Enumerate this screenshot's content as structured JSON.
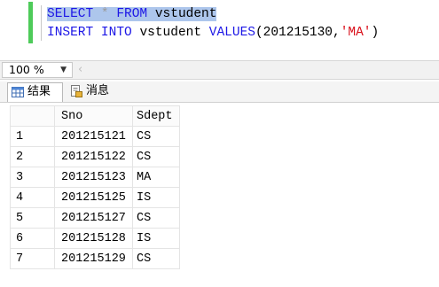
{
  "editor": {
    "line1": {
      "kw_select": "SELECT",
      "star": "*",
      "kw_from": "FROM",
      "table": "vstudent"
    },
    "line2": {
      "kw_insert": "INSERT",
      "kw_into": "INTO",
      "table": "vstudent",
      "kw_values": "VALUES",
      "args_open": "(201215130,",
      "str_val": "'MA'",
      "args_close": ")"
    }
  },
  "zoom": {
    "value": "100 %"
  },
  "tabs": {
    "results_label": "结果",
    "messages_label": "消息"
  },
  "grid": {
    "columns": [
      "",
      "Sno",
      "Sdept"
    ],
    "rows": [
      {
        "num": "1",
        "sno": "201215121",
        "sdept": "CS"
      },
      {
        "num": "2",
        "sno": "201215122",
        "sdept": "CS"
      },
      {
        "num": "3",
        "sno": "201215123",
        "sdept": "MA"
      },
      {
        "num": "4",
        "sno": "201215125",
        "sdept": "IS"
      },
      {
        "num": "5",
        "sno": "201215127",
        "sdept": "CS"
      },
      {
        "num": "6",
        "sno": "201215128",
        "sdept": "IS"
      },
      {
        "num": "7",
        "sno": "201215129",
        "sdept": "CS"
      }
    ]
  },
  "colors": {
    "selection": "#adc6ec",
    "keyword": "#1d17e6",
    "string": "#d9101b",
    "change_marker": "#4ecb5a"
  }
}
